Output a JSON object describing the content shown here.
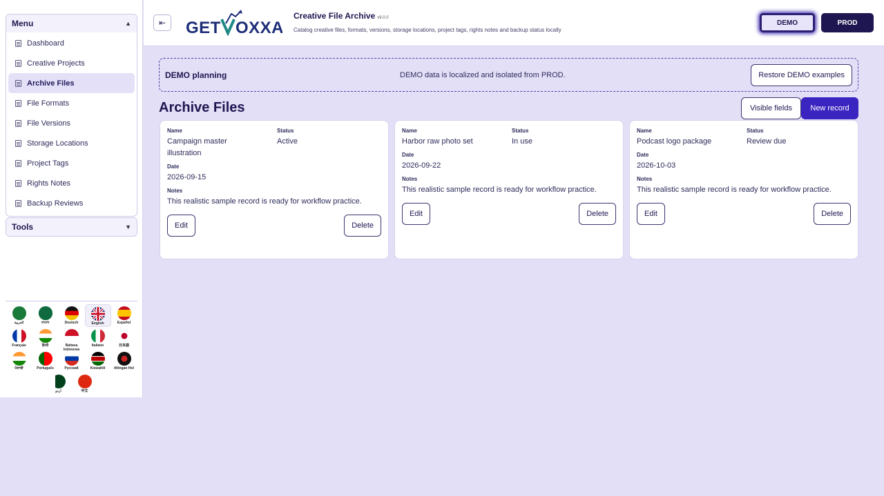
{
  "sidebar": {
    "menu_title": "Menu",
    "menu_items": [
      {
        "label": "Dashboard",
        "active": false
      },
      {
        "label": "Creative Projects",
        "active": false
      },
      {
        "label": "Archive Files",
        "active": true
      },
      {
        "label": "File Formats",
        "active": false
      },
      {
        "label": "File Versions",
        "active": false
      },
      {
        "label": "Storage Locations",
        "active": false
      },
      {
        "label": "Project Tags",
        "active": false
      },
      {
        "label": "Rights Notes",
        "active": false
      },
      {
        "label": "Backup Reviews",
        "active": false
      }
    ],
    "tools_title": "Tools",
    "languages": [
      {
        "label": "العربية",
        "selected": false
      },
      {
        "label": "বাংলা",
        "selected": false
      },
      {
        "label": "Deutsch",
        "selected": false
      },
      {
        "label": "English",
        "selected": true
      },
      {
        "label": "Español",
        "selected": false
      },
      {
        "label": "Français",
        "selected": false
      },
      {
        "label": "हिन्दी",
        "selected": false
      },
      {
        "label": "Bahasa Indonesia",
        "selected": false
      },
      {
        "label": "Italiano",
        "selected": false
      },
      {
        "label": "日本語",
        "selected": false
      },
      {
        "label": "ਪੰਜਾਬੀ",
        "selected": false
      },
      {
        "label": "Português",
        "selected": false
      },
      {
        "label": "Русский",
        "selected": false
      },
      {
        "label": "Kiswahili",
        "selected": false
      },
      {
        "label": "tlhIngan Hol",
        "selected": false
      },
      {
        "label": "اردو",
        "selected": false
      },
      {
        "label": "中文",
        "selected": false
      }
    ]
  },
  "header": {
    "logo": "GETVOXXA",
    "app_title": "Creative File Archive",
    "version": "v9.0.0",
    "subtitle": "Catalog creative files, formats, versions, storage locations, project tags, rights notes and backup status locally",
    "env_demo": "DEMO",
    "env_prod": "PROD"
  },
  "banner": {
    "title": "DEMO planning",
    "message": "DEMO data is localized and isolated from PROD.",
    "restore_label": "Restore DEMO examples"
  },
  "main": {
    "title": "Archive Files",
    "visible_fields_label": "Visible fields",
    "new_record_label": "New record",
    "field_labels": {
      "name": "Name",
      "status": "Status",
      "date": "Date",
      "notes": "Notes"
    },
    "edit_label": "Edit",
    "delete_label": "Delete",
    "records": [
      {
        "name": "Campaign master illustration",
        "status": "Active",
        "date": "2026-09-15",
        "notes": "This realistic sample record is ready for workflow practice."
      },
      {
        "name": "Harbor raw photo set",
        "status": "In use",
        "date": "2026-09-22",
        "notes": "This realistic sample record is ready for workflow practice."
      },
      {
        "name": "Podcast logo package",
        "status": "Review due",
        "date": "2026-10-03",
        "notes": "This realistic sample record is ready for workflow practice."
      }
    ]
  },
  "colors": {
    "accent": "#3b25c0",
    "dark": "#1e1650",
    "background": "#e3dff7"
  }
}
